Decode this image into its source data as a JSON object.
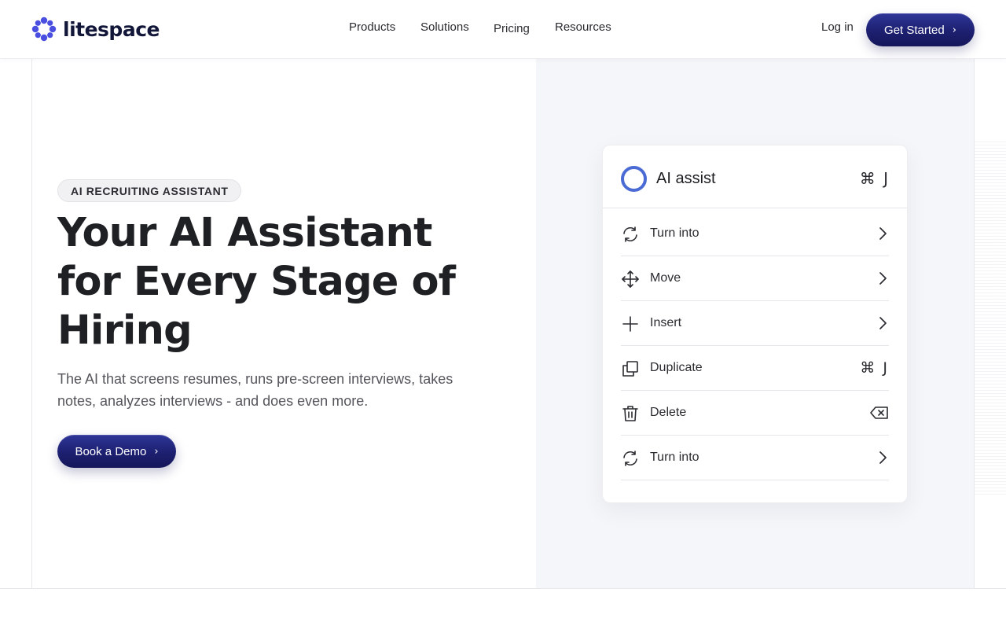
{
  "brand": {
    "name": "litespace",
    "accent": "#4a4fe0",
    "dark": "#15165a"
  },
  "nav": {
    "items": [
      "Products",
      "Solutions",
      "Pricing",
      "Resources"
    ],
    "login_label": "Log in",
    "cta_label": "Get Started"
  },
  "hero": {
    "badge": "AI RECRUITING ASSISTANT",
    "title": "Your AI Assistant for Every Stage of Hiring",
    "subtitle": "The AI that screens resumes, runs pre-screen interviews, takes notes, analyzes interviews - and does even more.",
    "cta_label": "Book a Demo"
  },
  "menu_card": {
    "title": "AI assist",
    "shortcut": "⌘ J",
    "items": [
      {
        "label": "Turn into",
        "icon": "refresh-icon",
        "right": "chevron-right-icon"
      },
      {
        "label": "Move",
        "icon": "move-arrows-icon",
        "right": "chevron-right-icon"
      },
      {
        "label": "Insert",
        "icon": "plus-icon",
        "right": "chevron-right-icon"
      },
      {
        "label": "Duplicate",
        "icon": "duplicate-icon",
        "right_text": "⌘ J"
      },
      {
        "label": "Delete",
        "icon": "trash-icon",
        "right": "backspace-icon"
      },
      {
        "label": "Turn into",
        "icon": "refresh-icon",
        "right": "chevron-right-icon"
      }
    ]
  }
}
